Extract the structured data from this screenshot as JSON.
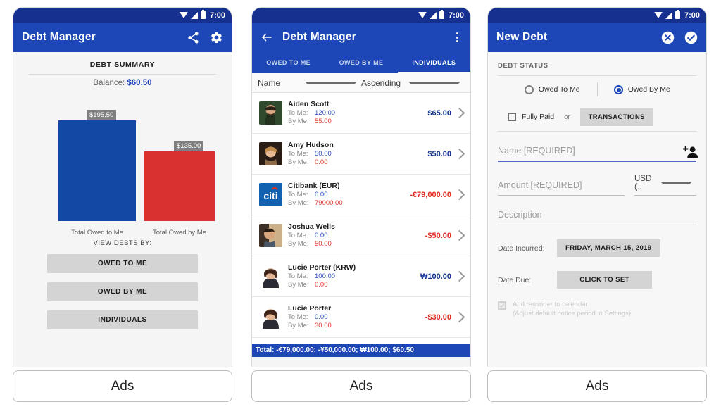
{
  "statusbar": {
    "time": "7:00",
    "icons": [
      "wifi-icon",
      "signal-icon",
      "battery-icon"
    ]
  },
  "colors": {
    "statusbar_navy": "#15308f",
    "appbar_blue": "#1d47b6",
    "bar_blue": "#1448a5",
    "bar_red": "#d93030",
    "positive": "#16328f",
    "negative": "#e02b20",
    "button_gray": "#d4d4d4"
  },
  "ads_label": "Ads",
  "screen1": {
    "title": "Debt Manager",
    "actions": [
      {
        "name": "share-icon",
        "label": "Share"
      },
      {
        "name": "gear-icon",
        "label": "Settings"
      }
    ],
    "summary_heading": "DEBT SUMMARY",
    "balance_label": "Balance:",
    "balance_value": "$60.50",
    "view_debts_by_label": "VIEW DEBTS BY:",
    "buttons": [
      {
        "label": "OWED TO ME"
      },
      {
        "label": "OWED BY ME"
      },
      {
        "label": "INDIVIDUALS"
      }
    ],
    "chart_data": {
      "type": "bar",
      "title": "DEBT SUMMARY",
      "categories": [
        "Total Owed to Me",
        "Total Owed by Me"
      ],
      "values": [
        195.5,
        135.0
      ],
      "data_labels": [
        "$195.50",
        "$135.00"
      ],
      "colors": [
        "#1448a5",
        "#d93030"
      ],
      "xlabel": "",
      "ylabel": "",
      "ylim": [
        0,
        210
      ],
      "grid": false,
      "legend": "none"
    }
  },
  "screen2": {
    "title": "Debt Manager",
    "back_icon": "back-arrow-icon",
    "overflow_icon": "overflow-menu-icon",
    "tabs": [
      {
        "label": "OWED TO ME",
        "active": false
      },
      {
        "label": "OWED BY ME",
        "active": false
      },
      {
        "label": "INDIVIDUALS",
        "active": true
      }
    ],
    "sort": {
      "field": "Name",
      "direction": "Ascending"
    },
    "row_labels": {
      "to_me": "To Me:",
      "by_me": "By Me:"
    },
    "rows": [
      {
        "name": "Aiden Scott",
        "to_me": "120.00",
        "by_me": "55.00",
        "amount": "$65.00",
        "sign": "pos",
        "avatar": "photo-male-1"
      },
      {
        "name": "Amy Hudson",
        "to_me": "50.00",
        "by_me": "0.00",
        "amount": "$50.00",
        "sign": "pos",
        "avatar": "photo-female-1"
      },
      {
        "name": "Citibank (EUR)",
        "to_me": "0.00",
        "by_me": "79000.00",
        "amount": "-€79,000.00",
        "sign": "neg",
        "avatar": "logo-citi"
      },
      {
        "name": "Joshua Wells",
        "to_me": "0.00",
        "by_me": "50.00",
        "amount": "-$50.00",
        "sign": "neg",
        "avatar": "photo-male-2"
      },
      {
        "name": "Lucie Porter (KRW)",
        "to_me": "100.00",
        "by_me": "0.00",
        "amount": "₩100.00",
        "sign": "pos",
        "avatar": "photo-female-2"
      },
      {
        "name": "Lucie Porter",
        "to_me": "0.00",
        "by_me": "30.00",
        "amount": "-$30.00",
        "sign": "neg",
        "avatar": "photo-female-2"
      }
    ],
    "total": "Total: -€79,000.00; -¥50,000.00; ₩100.00; $60.50"
  },
  "screen3": {
    "title": "New Debt",
    "cancel_icon": "close-circle-icon",
    "confirm_icon": "check-circle-icon",
    "section_label": "DEBT STATUS",
    "radio_owed_to_me": "Owed To Me",
    "radio_owed_by_me": "Owed By Me",
    "radio_selected": "Owed By Me",
    "fully_paid_label": "Fully Paid",
    "fully_paid_checked": false,
    "or_label": "or",
    "transactions_button": "TRANSACTIONS",
    "name_placeholder": "Name [REQUIRED]",
    "name_value": "",
    "add_person_icon": "add-person-icon",
    "amount_placeholder": "Amount [REQUIRED]",
    "amount_value": "",
    "currency_value": "USD (..",
    "description_placeholder": "Description",
    "description_value": "",
    "date_incurred_label": "Date Incurred:",
    "date_incurred_value": "FRIDAY, MARCH 15, 2019",
    "date_due_label": "Date Due:",
    "date_due_value": "CLICK TO SET",
    "reminder_label": "Add reminder to calendar",
    "reminder_sub": "(Adjust default notice period in Settings)",
    "reminder_checked": true,
    "reminder_enabled": false
  }
}
